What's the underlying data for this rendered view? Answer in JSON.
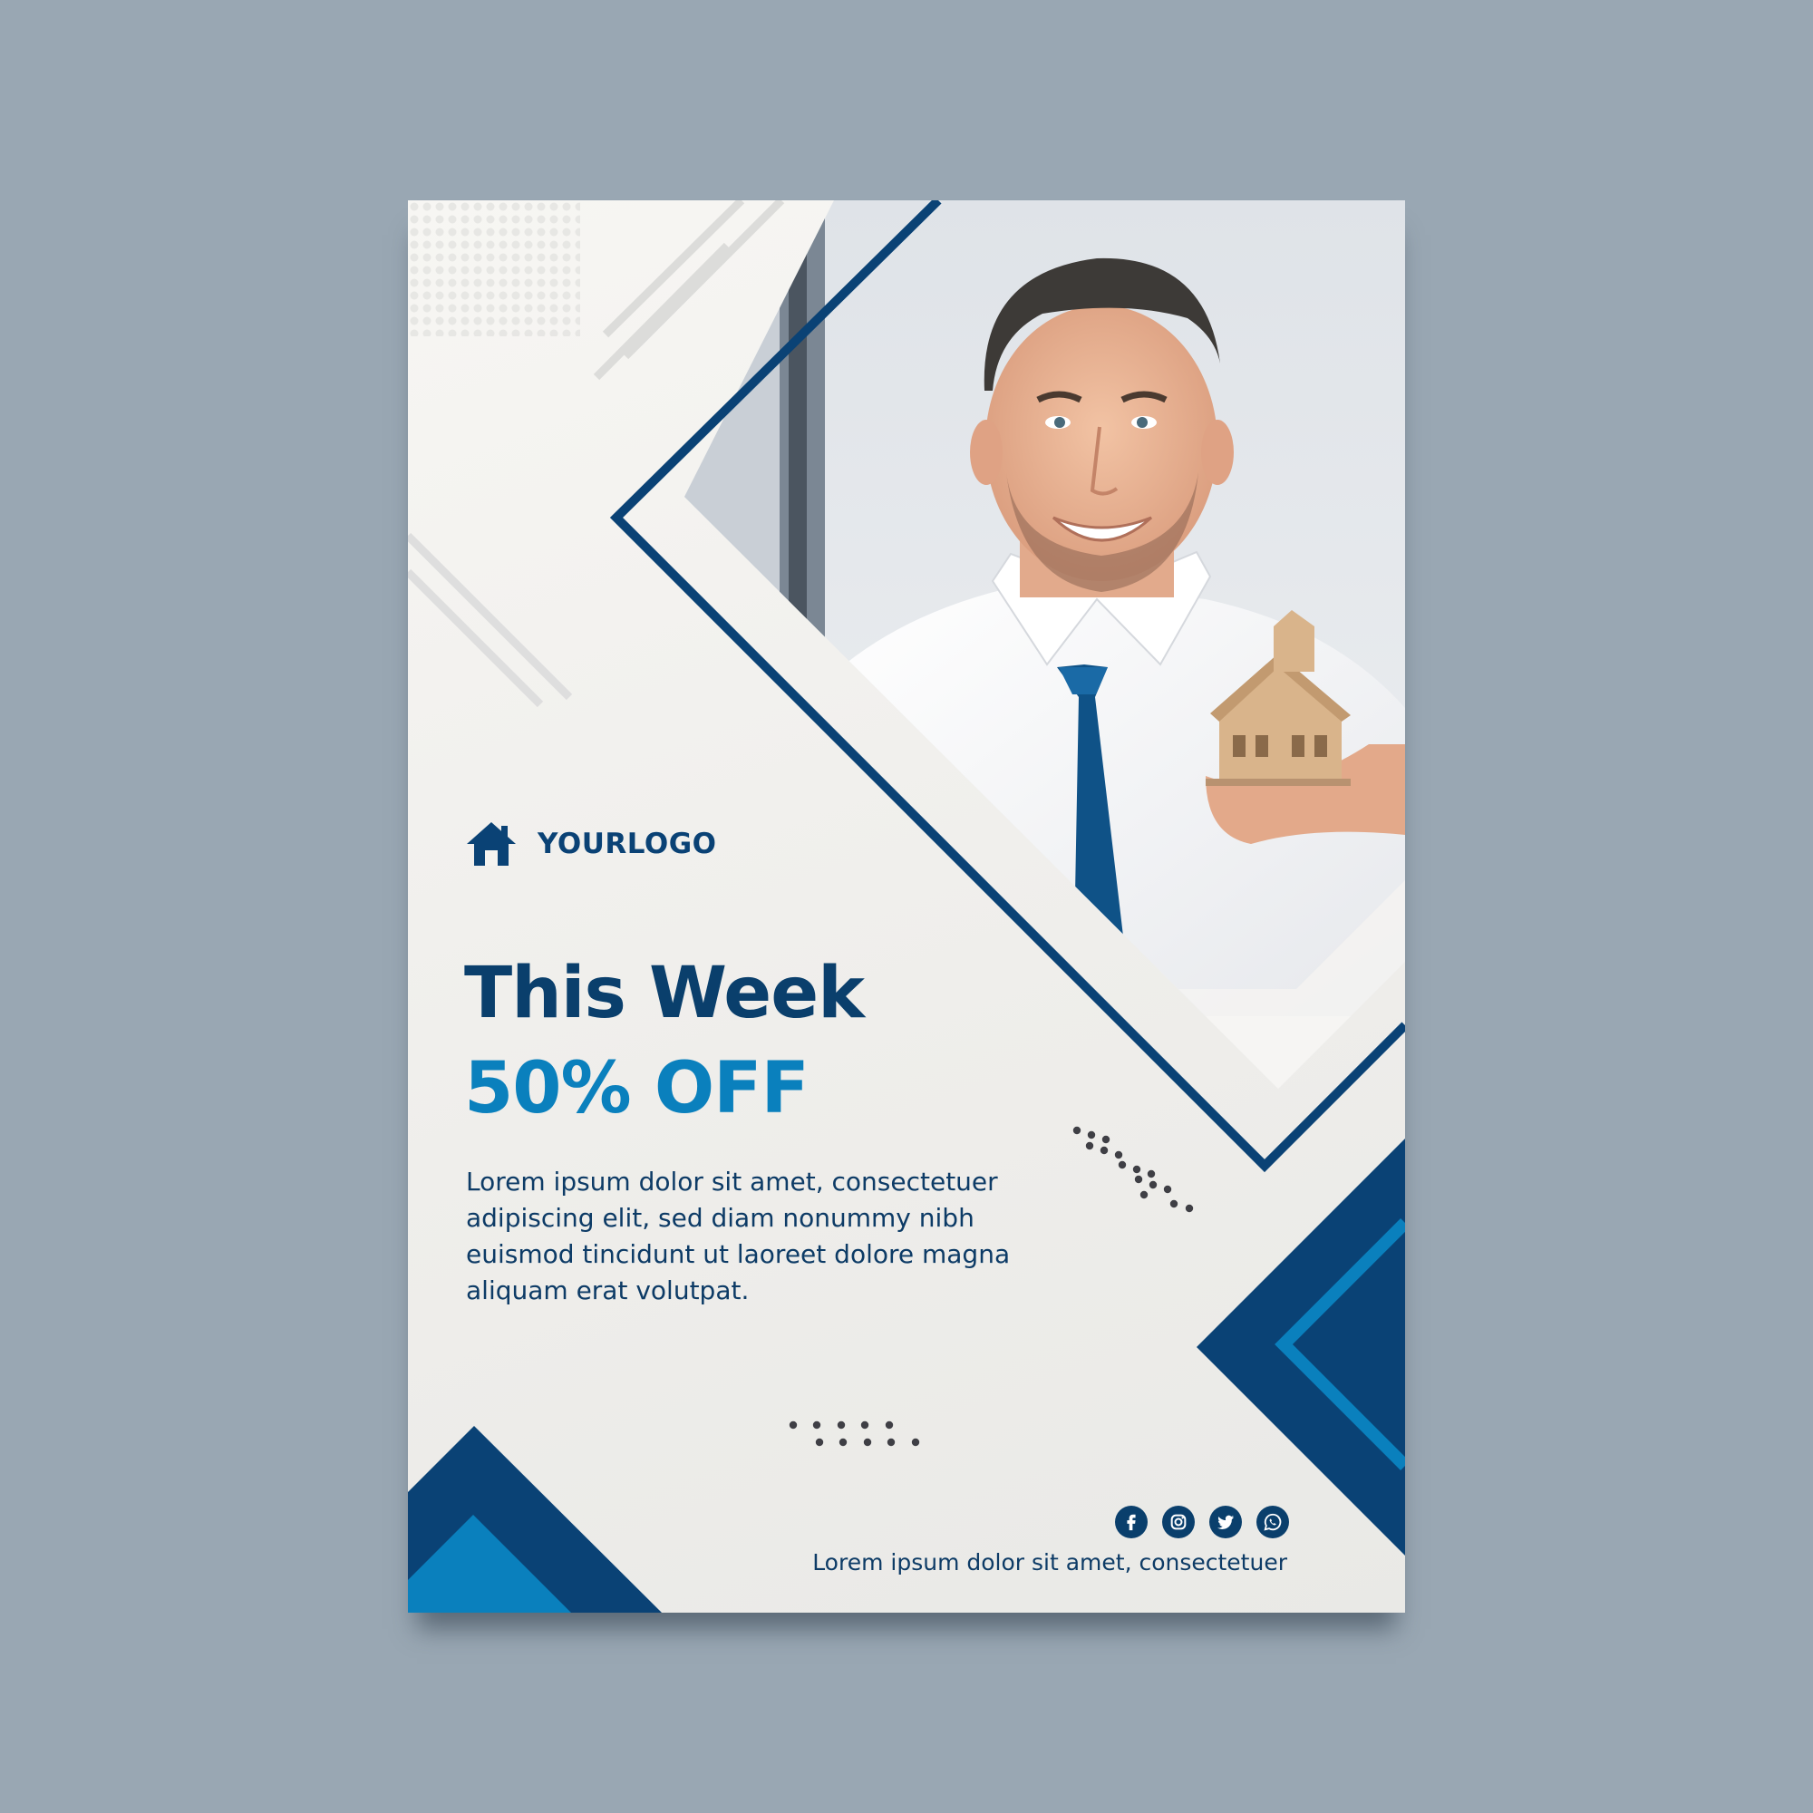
{
  "logo": {
    "text": "YOURLOGO",
    "icon": "house-icon"
  },
  "headline": {
    "line1": "This Week",
    "line2": "50% OFF"
  },
  "body": "Lorem ipsum dolor sit amet, consectetuer adipiscing elit, sed diam nonummy nibh euismod tincidunt ut laoreet dolore magna aliquam erat volutpat.",
  "social": [
    "facebook-icon",
    "instagram-icon",
    "twitter-icon",
    "whatsapp-icon"
  ],
  "footer": "Lorem ipsum dolor sit amet, consectetuer",
  "colors": {
    "background": "#99a7b3",
    "navy": "#0a4275",
    "accent_blue": "#0a80bd",
    "paper": "#f3f2ef"
  }
}
